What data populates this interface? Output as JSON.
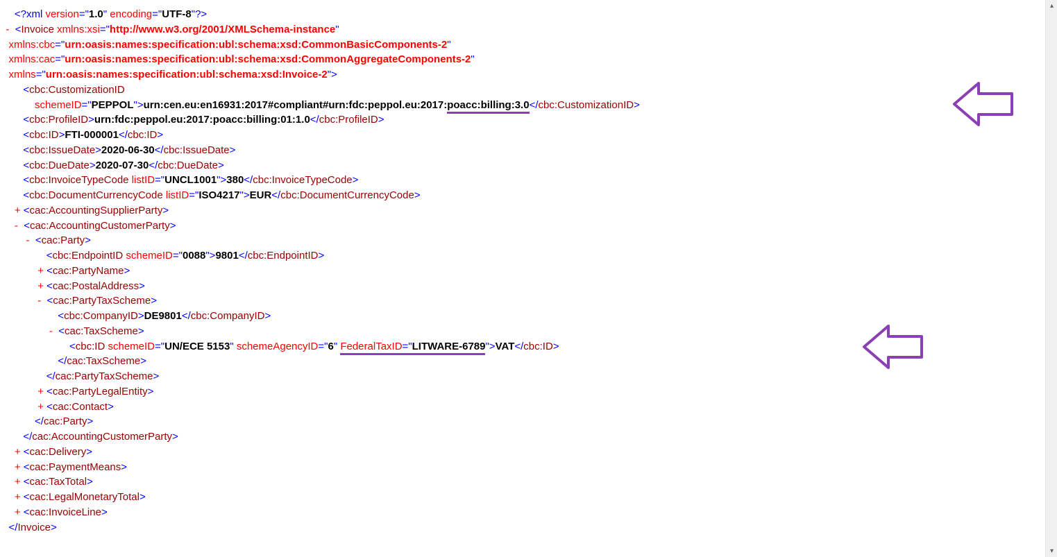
{
  "xml": {
    "decl_open": "<?xml ",
    "decl_attr_version_name": "version",
    "decl_attr_version_eq": "=\"",
    "decl_attr_version_val": "1.0",
    "decl_attr_encoding_name": "encoding",
    "decl_attr_encoding_eq": "=\"",
    "decl_attr_encoding_val": "UTF-8",
    "decl_close": "\"?>",
    "tog_minus": "-",
    "tog_plus": "+",
    "invoice_open_lt": "<",
    "invoice_tag": "Invoice",
    "attr_xsi_name": "xmlns:xsi",
    "attr_xsi_val": "http://www.w3.org/2001/XMLSchema-instance",
    "attr_cbc_name": "xmlns:cbc",
    "attr_cbc_val": "urn:oasis:names:specification:ubl:schema:xsd:CommonBasicComponents-2",
    "attr_cac_name": "xmlns:cac",
    "attr_cac_val": "urn:oasis:names:specification:ubl:schema:xsd:CommonAggregateComponents-2",
    "attr_xmlns_name": "xmlns",
    "attr_xmlns_val": "urn:oasis:names:specification:ubl:schema:xsd:Invoice-2",
    "gt": ">",
    "eq_open": "=\"",
    "q": "\"",
    "customizationID_tag": "cbc:CustomizationID",
    "customizationID_schemeID_name": "schemeID",
    "customizationID_schemeID_val": "PEPPOL",
    "customizationID_val_a": "urn:cen.eu:en16931:2017#compliant#urn:fdc:peppol.eu:2017:",
    "customizationID_val_b": "poacc:billing:3.0",
    "customizationID_close": "</",
    "slash_gt": ">",
    "profileID_tag": "cbc:ProfileID",
    "profileID_val": "urn:fdc:peppol.eu:2017:poacc:billing:01:1.0",
    "id_tag": "cbc:ID",
    "id_val": "FTI-000001",
    "issueDate_tag": "cbc:IssueDate",
    "issueDate_val": "2020-06-30",
    "dueDate_tag": "cbc:DueDate",
    "dueDate_val": "2020-07-30",
    "invoiceTypeCode_tag": "cbc:InvoiceTypeCode",
    "invoiceTypeCode_listID_name": "listID",
    "invoiceTypeCode_listID_val": "UNCL1001",
    "invoiceTypeCode_val": "380",
    "docCurrency_tag": "cbc:DocumentCurrencyCode",
    "docCurrency_listID_name": "listID",
    "docCurrency_listID_val": "ISO4217",
    "docCurrency_val": "EUR",
    "acctSupplierParty_tag": "cac:AccountingSupplierParty",
    "acctCustomerParty_tag": "cac:AccountingCustomerParty",
    "party_tag": "cac:Party",
    "endpointID_tag": "cbc:EndpointID",
    "endpointID_schemeID_name": "schemeID",
    "endpointID_schemeID_val": "0088",
    "endpointID_val": "9801",
    "partyName_tag": "cac:PartyName",
    "postalAddress_tag": "cac:PostalAddress",
    "partyTaxScheme_tag": "cac:PartyTaxScheme",
    "companyID_tag": "cbc:CompanyID",
    "companyID_val": "DE9801",
    "taxScheme_tag": "cac:TaxScheme",
    "taxID_tag": "cbc:ID",
    "taxID_schemeID_name": "schemeID",
    "taxID_schemeID_val": "UN/ECE 5153",
    "taxID_schemeAgencyID_name": "schemeAgencyID",
    "taxID_schemeAgencyID_val": "6",
    "taxID_fedName": "FederalTaxID",
    "taxID_fedVal": "LITWARE-6789",
    "taxID_val": "VAT",
    "partyLegalEntity_tag": "cac:PartyLegalEntity",
    "contact_tag": "cac:Contact",
    "delivery_tag": "cac:Delivery",
    "paymentMeans_tag": "cac:PaymentMeans",
    "taxTotal_tag": "cac:TaxTotal",
    "legalMonetaryTotal_tag": "cac:LegalMonetaryTotal",
    "invoiceLine_tag": "cac:InvoiceLine",
    "invoice_close": "</",
    "space": " "
  }
}
